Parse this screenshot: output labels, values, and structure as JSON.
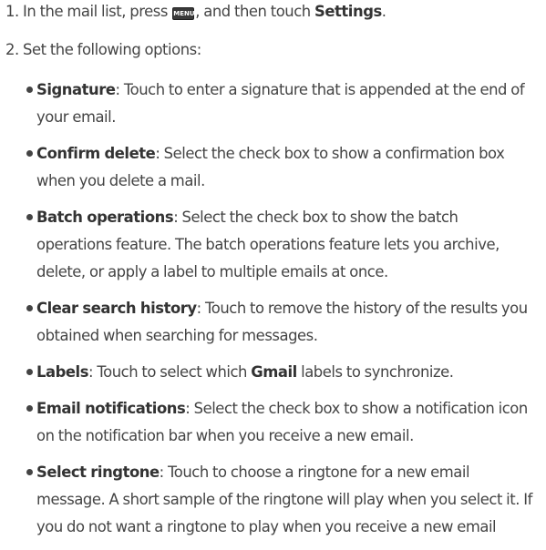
{
  "step1": {
    "prefix": "1. In the mail list, press",
    "key_label": "MENU",
    "middle": ", and then touch",
    "target": "Settings",
    "suffix": "."
  },
  "step2": {
    "text": "2. Set the following options:"
  },
  "options": [
    {
      "title": "Signature",
      "desc": ": Touch to enter a signature that is appended at the end of your email."
    },
    {
      "title": "Confirm delete",
      "desc": ": Select the check box to show a confirmation box when you delete a mail."
    },
    {
      "title": "Batch operations",
      "desc": ": Select the check box to show the batch operations feature. The batch operations feature lets you archive, delete, or apply a label to multiple emails at once."
    },
    {
      "title": "Clear search history",
      "desc": ": Touch to remove the history of the results you obtained when searching for messages."
    },
    {
      "title": "Labels",
      "desc_pre": ": Touch to select which ",
      "desc_bold": "Gmail",
      "desc_post": " labels to synchronize."
    },
    {
      "title": "Email notifications",
      "desc": ": Select the check box to show a notification icon on the notification bar when you receive a new email."
    },
    {
      "title": "Select ringtone",
      "desc": ": Touch to choose a ringtone for a new email message. A short sample of the ringtone will play when you select it. If you do not want a ringtone to play when you receive a new email"
    }
  ]
}
